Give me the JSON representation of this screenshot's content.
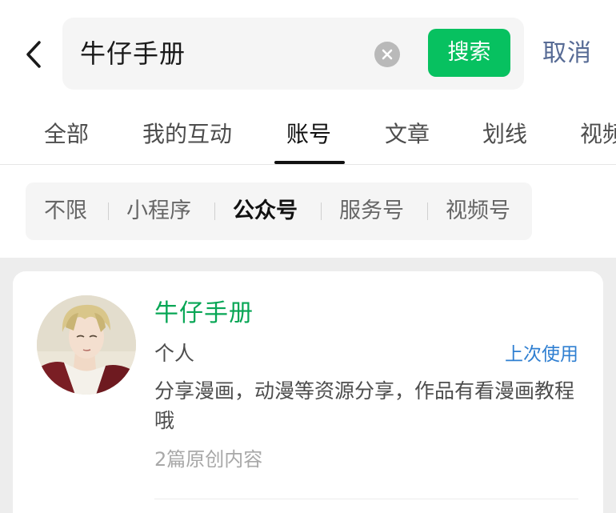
{
  "search": {
    "query": "牛仔手册",
    "search_label": "搜索",
    "cancel_label": "取消"
  },
  "tabs": [
    {
      "label": "全部",
      "active": false
    },
    {
      "label": "我的互动",
      "active": false
    },
    {
      "label": "账号",
      "active": true
    },
    {
      "label": "文章",
      "active": false
    },
    {
      "label": "划线",
      "active": false
    },
    {
      "label": "视频",
      "active": false
    }
  ],
  "filters": [
    {
      "label": "不限",
      "active": false
    },
    {
      "label": "小程序",
      "active": false
    },
    {
      "label": "公众号",
      "active": true
    },
    {
      "label": "服务号",
      "active": false
    },
    {
      "label": "视频号",
      "active": false
    }
  ],
  "result": {
    "name": "牛仔手册",
    "type": "个人",
    "badge": "上次使用",
    "description": "分享漫画，动漫等资源分享，作品有看漫画教程哦",
    "meta": "2篇原创内容",
    "avatar": "avatar-illustration-blonde-man"
  },
  "colors": {
    "accent_green": "#07c160",
    "name_green": "#07a655",
    "link_blue": "#2f7fd1",
    "cancel_blue": "#576b95",
    "page_gray": "#ededed"
  },
  "icons": {
    "back": "chevron-left-icon",
    "clear": "clear-x-icon"
  }
}
